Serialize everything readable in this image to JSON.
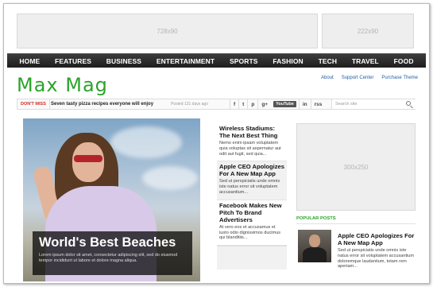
{
  "ads": {
    "leaderboard": "728x90",
    "small": "222x90",
    "sidebar": "300x250"
  },
  "nav": {
    "items": [
      "HOME",
      "FEATURES",
      "BUSINESS",
      "ENTERTAINMENT",
      "SPORTS",
      "FASHION",
      "TECH",
      "TRAVEL",
      "FOOD"
    ]
  },
  "header": {
    "logo": "Max Mag",
    "links": [
      "About",
      "Support Center",
      "Purchase Theme"
    ]
  },
  "ticker": {
    "label": "DON'T MISS",
    "headline": "Seven tasty pizza recipes everyone will enjoy",
    "date": "Posted 131 days ago",
    "social": [
      "f",
      "t",
      "p",
      "g+",
      "YouTube",
      "in",
      "rss"
    ],
    "search_placeholder": "Search site"
  },
  "hero": {
    "title": "World's Best Beaches",
    "excerpt": "Lorem ipsum dolor sit amet, consectetur adipiscing elit, sed do eiusmod tempor incididunt ut labore et dolore magna aliqua."
  },
  "middle": {
    "articles": [
      {
        "title": "Wireless Stadiums: The Next Best Thing",
        "excerpt": "Nemo enim ipsam voluptatem quia voluptas sit aspernatur aut odit aut fugit, sed quia..."
      },
      {
        "title": "Apple CEO Apologizes For A New Map App",
        "excerpt": "Sed ut perspiciatis unde omnis iste natus error sit voluptatem accusantium..."
      },
      {
        "title": "Facebook Makes New Pitch To Brand Advertisers",
        "excerpt": "At vero eos et accusamus et iusto odio dignissimos ducimus qui blanditiis..."
      }
    ]
  },
  "popular": {
    "label": "POPULAR POSTS",
    "title": "Apple CEO Apologizes For A New Map App",
    "excerpt": "Sed ut perspiciatis unde omnis iste natus error sit voluptatem accusantium doloremque laudantium, totam rem aperiam..."
  },
  "colors": {
    "accent": "#2ba32b",
    "nav_bg": "#262626",
    "link": "#1f5fa8",
    "alert": "#d42a2a"
  }
}
